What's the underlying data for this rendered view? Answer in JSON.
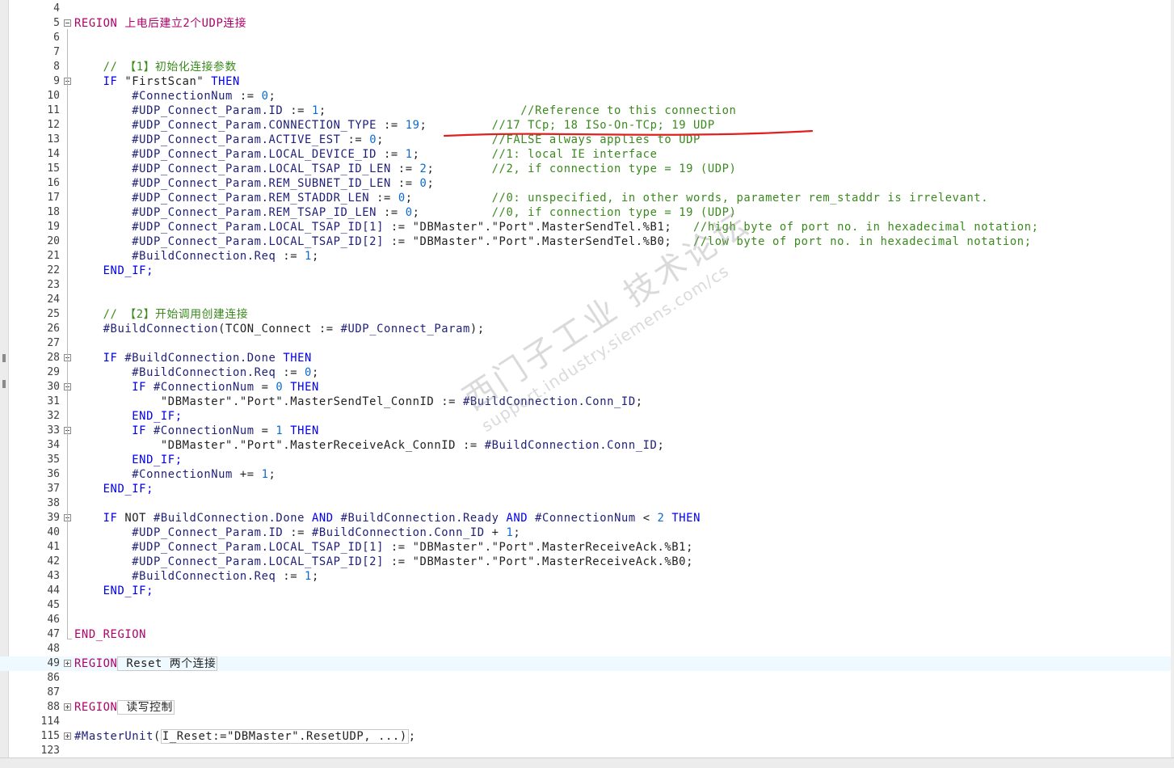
{
  "watermark": {
    "line1": "西门子工业 技术论坛",
    "line2": "support.industry.siemens.com/cs"
  },
  "lines": [
    {
      "n": "4",
      "tokens": []
    },
    {
      "n": "5",
      "fold": "minus",
      "tokens": [
        {
          "t": "REGION",
          "c": "rg"
        },
        {
          "t": " 上电后建立2个UDP连接",
          "c": "rg"
        }
      ]
    },
    {
      "n": "6",
      "tokens": []
    },
    {
      "n": "7",
      "tokens": []
    },
    {
      "n": "8",
      "tokens": [
        {
          "t": "    // ",
          "c": "cm"
        },
        {
          "t": "【1】初始化连接参数",
          "c": "cm"
        }
      ]
    },
    {
      "n": "9",
      "fold": "minus",
      "tokens": [
        {
          "t": "    IF ",
          "c": "kw"
        },
        {
          "t": "\"FirstScan\"",
          "c": "str"
        },
        {
          "t": " THEN",
          "c": "kw"
        }
      ]
    },
    {
      "n": "10",
      "tokens": [
        {
          "t": "        #ConnectionNum",
          "c": "id"
        },
        {
          "t": " := ",
          "c": "op"
        },
        {
          "t": "0",
          "c": "num"
        },
        {
          "t": ";",
          "c": "op"
        }
      ]
    },
    {
      "n": "11",
      "tokens": [
        {
          "t": "        #UDP_Connect_Param.ID",
          "c": "id"
        },
        {
          "t": " := ",
          "c": "op"
        },
        {
          "t": "1",
          "c": "num"
        },
        {
          "t": ";                           ",
          "c": "op"
        },
        {
          "t": "//Reference to this connection",
          "c": "cm"
        }
      ]
    },
    {
      "n": "12",
      "tokens": [
        {
          "t": "        #UDP_Connect_Param.CONNECTION_TYPE",
          "c": "id"
        },
        {
          "t": " := ",
          "c": "op"
        },
        {
          "t": "19",
          "c": "num"
        },
        {
          "t": ";         ",
          "c": "op"
        },
        {
          "t": "//17 TCp; 18 ISo-On-TCp; 19 UDP",
          "c": "cm"
        }
      ]
    },
    {
      "n": "13",
      "tokens": [
        {
          "t": "        #UDP_Connect_Param.ACTIVE_EST",
          "c": "id"
        },
        {
          "t": " := ",
          "c": "op"
        },
        {
          "t": "0",
          "c": "num"
        },
        {
          "t": ";               ",
          "c": "op"
        },
        {
          "t": "//FALSE always applies to UDP",
          "c": "cm"
        }
      ]
    },
    {
      "n": "14",
      "tokens": [
        {
          "t": "        #UDP_Connect_Param.LOCAL_DEVICE_ID",
          "c": "id"
        },
        {
          "t": " := ",
          "c": "op"
        },
        {
          "t": "1",
          "c": "num"
        },
        {
          "t": ";          ",
          "c": "op"
        },
        {
          "t": "//1: local IE interface",
          "c": "cm"
        }
      ]
    },
    {
      "n": "15",
      "tokens": [
        {
          "t": "        #UDP_Connect_Param.LOCAL_TSAP_ID_LEN",
          "c": "id"
        },
        {
          "t": " := ",
          "c": "op"
        },
        {
          "t": "2",
          "c": "num"
        },
        {
          "t": ";        ",
          "c": "op"
        },
        {
          "t": "//2, if connection type = 19 (UDP)",
          "c": "cm"
        }
      ]
    },
    {
      "n": "16",
      "tokens": [
        {
          "t": "        #UDP_Connect_Param.REM_SUBNET_ID_LEN",
          "c": "id"
        },
        {
          "t": " := ",
          "c": "op"
        },
        {
          "t": "0",
          "c": "num"
        },
        {
          "t": ";",
          "c": "op"
        }
      ]
    },
    {
      "n": "17",
      "tokens": [
        {
          "t": "        #UDP_Connect_Param.REM_STADDR_LEN",
          "c": "id"
        },
        {
          "t": " := ",
          "c": "op"
        },
        {
          "t": "0",
          "c": "num"
        },
        {
          "t": ";           ",
          "c": "op"
        },
        {
          "t": "//0: unspecified, in other words, parameter rem_staddr is irrelevant.",
          "c": "cm"
        }
      ]
    },
    {
      "n": "18",
      "tokens": [
        {
          "t": "        #UDP_Connect_Param.REM_TSAP_ID_LEN",
          "c": "id"
        },
        {
          "t": " := ",
          "c": "op"
        },
        {
          "t": "0",
          "c": "num"
        },
        {
          "t": ";          ",
          "c": "op"
        },
        {
          "t": "//0, if connection type = 19 (UDP)",
          "c": "cm"
        }
      ]
    },
    {
      "n": "19",
      "tokens": [
        {
          "t": "        #UDP_Connect_Param.LOCAL_TSAP_ID[1]",
          "c": "id"
        },
        {
          "t": " := ",
          "c": "op"
        },
        {
          "t": "\"DBMaster\".\"Port\".MasterSendTel.%B1;",
          "c": "str"
        },
        {
          "t": "   ",
          "c": "op"
        },
        {
          "t": "//high byte of port no. in hexadecimal notation;",
          "c": "cm"
        }
      ]
    },
    {
      "n": "20",
      "tokens": [
        {
          "t": "        #UDP_Connect_Param.LOCAL_TSAP_ID[2]",
          "c": "id"
        },
        {
          "t": " := ",
          "c": "op"
        },
        {
          "t": "\"DBMaster\".\"Port\".MasterSendTel.%B0;",
          "c": "str"
        },
        {
          "t": "   ",
          "c": "op"
        },
        {
          "t": "//low byte of port no. in hexadecimal notation;",
          "c": "cm"
        }
      ]
    },
    {
      "n": "21",
      "tokens": [
        {
          "t": "        #BuildConnection.Req",
          "c": "id"
        },
        {
          "t": " := ",
          "c": "op"
        },
        {
          "t": "1",
          "c": "num"
        },
        {
          "t": ";",
          "c": "op"
        }
      ]
    },
    {
      "n": "22",
      "tokens": [
        {
          "t": "    END_IF;",
          "c": "kw"
        }
      ]
    },
    {
      "n": "23",
      "tokens": []
    },
    {
      "n": "24",
      "tokens": []
    },
    {
      "n": "25",
      "tokens": [
        {
          "t": "    // ",
          "c": "cm"
        },
        {
          "t": "【2】开始调用创建连接",
          "c": "cm"
        }
      ]
    },
    {
      "n": "26",
      "tokens": [
        {
          "t": "    #BuildConnection",
          "c": "id"
        },
        {
          "t": "(TCON_Connect",
          "c": "op"
        },
        {
          "t": " := ",
          "c": "op"
        },
        {
          "t": "#UDP_Connect_Param",
          "c": "id"
        },
        {
          "t": ");",
          "c": "op"
        }
      ]
    },
    {
      "n": "27",
      "tokens": []
    },
    {
      "n": "28",
      "fold": "minus",
      "tokens": [
        {
          "t": "    IF ",
          "c": "kw"
        },
        {
          "t": "#BuildConnection.Done",
          "c": "id"
        },
        {
          "t": " THEN",
          "c": "kw"
        }
      ]
    },
    {
      "n": "29",
      "tokens": [
        {
          "t": "        #BuildConnection.Req",
          "c": "id"
        },
        {
          "t": " := ",
          "c": "op"
        },
        {
          "t": "0",
          "c": "num"
        },
        {
          "t": ";",
          "c": "op"
        }
      ]
    },
    {
      "n": "30",
      "fold": "minus",
      "tokens": [
        {
          "t": "        IF ",
          "c": "kw"
        },
        {
          "t": "#ConnectionNum",
          "c": "id"
        },
        {
          "t": " = ",
          "c": "op"
        },
        {
          "t": "0",
          "c": "num"
        },
        {
          "t": " THEN",
          "c": "kw"
        }
      ]
    },
    {
      "n": "31",
      "tokens": [
        {
          "t": "            \"DBMaster\".\"Port\".MasterSendTel_ConnID",
          "c": "str"
        },
        {
          "t": " := ",
          "c": "op"
        },
        {
          "t": "#BuildConnection.Conn_ID",
          "c": "id"
        },
        {
          "t": ";",
          "c": "op"
        }
      ]
    },
    {
      "n": "32",
      "tokens": [
        {
          "t": "        END_IF;",
          "c": "kw"
        }
      ]
    },
    {
      "n": "33",
      "fold": "minus",
      "tokens": [
        {
          "t": "        IF ",
          "c": "kw"
        },
        {
          "t": "#ConnectionNum",
          "c": "id"
        },
        {
          "t": " = ",
          "c": "op"
        },
        {
          "t": "1",
          "c": "num"
        },
        {
          "t": " THEN",
          "c": "kw"
        }
      ]
    },
    {
      "n": "34",
      "tokens": [
        {
          "t": "            \"DBMaster\".\"Port\".MasterReceiveAck_ConnID",
          "c": "str"
        },
        {
          "t": " := ",
          "c": "op"
        },
        {
          "t": "#BuildConnection.Conn_ID",
          "c": "id"
        },
        {
          "t": ";",
          "c": "op"
        }
      ]
    },
    {
      "n": "35",
      "tokens": [
        {
          "t": "        END_IF;",
          "c": "kw"
        }
      ]
    },
    {
      "n": "36",
      "tokens": [
        {
          "t": "        #ConnectionNum",
          "c": "id"
        },
        {
          "t": " += ",
          "c": "op"
        },
        {
          "t": "1",
          "c": "num"
        },
        {
          "t": ";",
          "c": "op"
        }
      ]
    },
    {
      "n": "37",
      "tokens": [
        {
          "t": "    END_IF;",
          "c": "kw"
        }
      ]
    },
    {
      "n": "38",
      "tokens": []
    },
    {
      "n": "39",
      "fold": "minus",
      "tokens": [
        {
          "t": "    IF ",
          "c": "kw"
        },
        {
          "t": "NOT ",
          "c": "op"
        },
        {
          "t": "#BuildConnection.Done",
          "c": "id"
        },
        {
          "t": " AND ",
          "c": "kw"
        },
        {
          "t": "#BuildConnection.Ready",
          "c": "id"
        },
        {
          "t": " AND ",
          "c": "kw"
        },
        {
          "t": "#ConnectionNum",
          "c": "id"
        },
        {
          "t": " < ",
          "c": "op"
        },
        {
          "t": "2",
          "c": "num"
        },
        {
          "t": " THEN",
          "c": "kw"
        }
      ]
    },
    {
      "n": "40",
      "tokens": [
        {
          "t": "        #UDP_Connect_Param.ID",
          "c": "id"
        },
        {
          "t": " := ",
          "c": "op"
        },
        {
          "t": "#BuildConnection.Conn_ID",
          "c": "id"
        },
        {
          "t": " + ",
          "c": "op"
        },
        {
          "t": "1",
          "c": "num"
        },
        {
          "t": ";",
          "c": "op"
        }
      ]
    },
    {
      "n": "41",
      "tokens": [
        {
          "t": "        #UDP_Connect_Param.LOCAL_TSAP_ID[1]",
          "c": "id"
        },
        {
          "t": " := ",
          "c": "op"
        },
        {
          "t": "\"DBMaster\".\"Port\".MasterReceiveAck.%B1;",
          "c": "str"
        }
      ]
    },
    {
      "n": "42",
      "tokens": [
        {
          "t": "        #UDP_Connect_Param.LOCAL_TSAP_ID[2]",
          "c": "id"
        },
        {
          "t": " := ",
          "c": "op"
        },
        {
          "t": "\"DBMaster\".\"Port\".MasterReceiveAck.%B0;",
          "c": "str"
        }
      ]
    },
    {
      "n": "43",
      "tokens": [
        {
          "t": "        #BuildConnection.Req",
          "c": "id"
        },
        {
          "t": " := ",
          "c": "op"
        },
        {
          "t": "1",
          "c": "num"
        },
        {
          "t": ";",
          "c": "op"
        }
      ]
    },
    {
      "n": "44",
      "tokens": [
        {
          "t": "    END_IF;",
          "c": "kw"
        }
      ]
    },
    {
      "n": "45",
      "tokens": []
    },
    {
      "n": "46",
      "tokens": []
    },
    {
      "n": "47",
      "tokens": [
        {
          "t": "END_REGION",
          "c": "rg"
        }
      ]
    },
    {
      "n": "48",
      "tokens": []
    },
    {
      "n": "49",
      "fold": "plus",
      "hl": true,
      "tokens": [
        {
          "t": "REGION",
          "c": "rg"
        },
        {
          "t": " Reset 两个连接",
          "c": "op",
          "box": true
        }
      ]
    },
    {
      "n": "86",
      "tokens": []
    },
    {
      "n": "87",
      "tokens": []
    },
    {
      "n": "88",
      "fold": "plus",
      "tokens": [
        {
          "t": "REGION",
          "c": "rg"
        },
        {
          "t": " 读写控制",
          "c": "op",
          "box": true
        }
      ]
    },
    {
      "n": "114",
      "tokens": []
    },
    {
      "n": "115",
      "fold": "plus",
      "tokens": [
        {
          "t": "#MasterUnit",
          "c": "id"
        },
        {
          "t": "(",
          "c": "op"
        },
        {
          "t": "I_Reset:=\"DBMaster\".ResetUDP, ...)",
          "c": "op",
          "box": true
        },
        {
          "t": ";",
          "c": "op"
        }
      ]
    },
    {
      "n": "123",
      "tokens": []
    }
  ]
}
